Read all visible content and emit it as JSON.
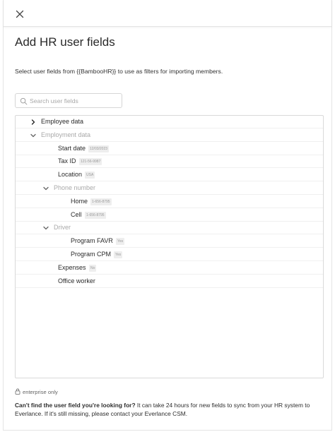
{
  "header": {
    "title": "Add HR user fields"
  },
  "description": "Select user fields from {{BambooHR}} to use as filters for importing members.",
  "search": {
    "placeholder": "Search user fields"
  },
  "tree": [
    {
      "label": "Employee data",
      "level": 0,
      "expandable": true,
      "expanded": false,
      "muted": false,
      "badge": ""
    },
    {
      "label": "Employment data",
      "level": 0,
      "expandable": true,
      "expanded": true,
      "muted": true,
      "badge": ""
    },
    {
      "label": "Start date",
      "level": 1,
      "expandable": false,
      "muted": false,
      "badge": "12/03/2023"
    },
    {
      "label": "Tax ID",
      "level": 1,
      "expandable": false,
      "muted": false,
      "badge": "121-56-9987"
    },
    {
      "label": "Location",
      "level": 1,
      "expandable": false,
      "muted": false,
      "badge": "USA"
    },
    {
      "label": "Phone number",
      "level": 1,
      "expandable": true,
      "expanded": true,
      "muted": true,
      "badge": ""
    },
    {
      "label": "Home",
      "level": 2,
      "expandable": false,
      "muted": false,
      "badge": "1-656-8795"
    },
    {
      "label": "Cell",
      "level": 2,
      "expandable": false,
      "muted": false,
      "badge": "1-656-8795"
    },
    {
      "label": "Driver",
      "level": 1,
      "expandable": true,
      "expanded": true,
      "muted": true,
      "badge": ""
    },
    {
      "label": "Program FAVR",
      "level": 2,
      "expandable": false,
      "muted": false,
      "badge": "Yes"
    },
    {
      "label": "Program CPM",
      "level": 2,
      "expandable": false,
      "muted": false,
      "badge": "Yes"
    },
    {
      "label": "Expenses",
      "level": 1,
      "expandable": false,
      "muted": false,
      "badge": "No"
    },
    {
      "label": "Office worker",
      "level": 1,
      "expandable": false,
      "muted": false,
      "badge": ""
    }
  ],
  "footer": {
    "enterprise_label": "enterprise only",
    "help_bold": "Can't find the user field you're looking for?",
    "help_text": " It can take 24 hours for new fields to sync from your HR system to Everlance. If it's still missing, please contact your Everlance CSM."
  }
}
